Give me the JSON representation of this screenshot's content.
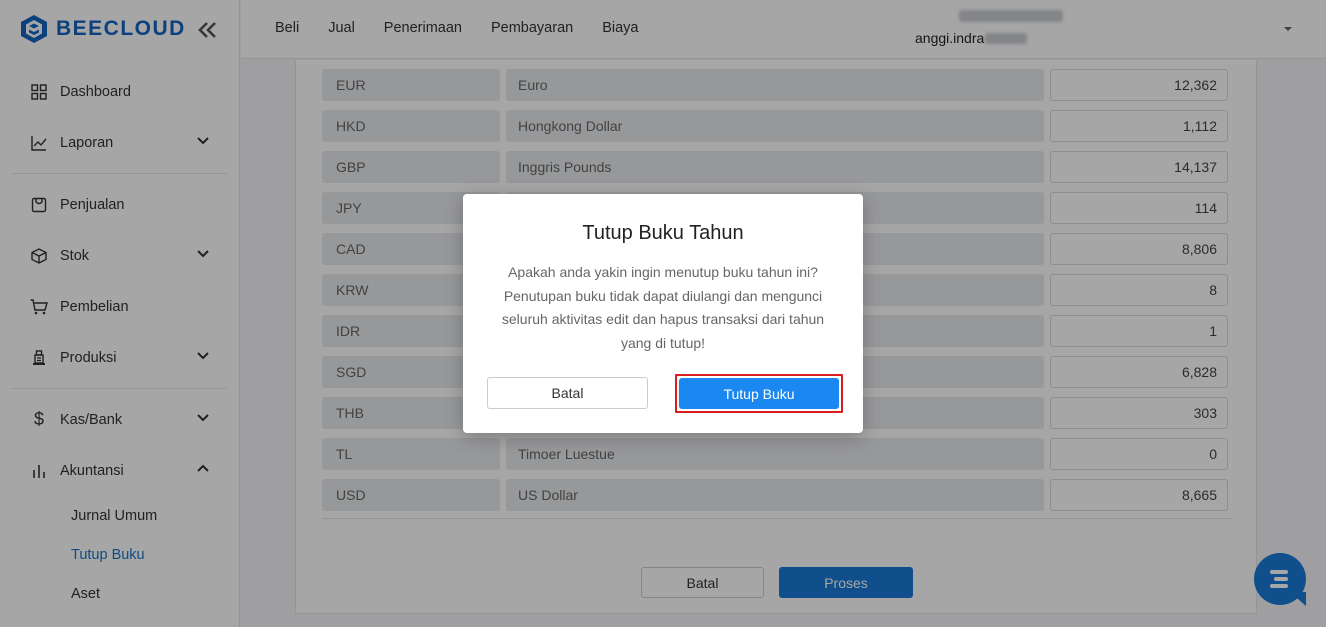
{
  "brand": {
    "name": "BEECLOUD",
    "color": "#1565c0"
  },
  "sidebar": {
    "items": [
      {
        "label": "Dashboard",
        "icon": "grid-icon"
      },
      {
        "label": "Laporan",
        "icon": "chart-line-icon"
      },
      {
        "label": "Penjualan",
        "icon": "receipt-icon"
      },
      {
        "label": "Stok",
        "icon": "box-icon"
      },
      {
        "label": "Pembelian",
        "icon": "cart-icon"
      },
      {
        "label": "Produksi",
        "icon": "factory-icon"
      },
      {
        "label": "Kas/Bank",
        "icon": "dollar-icon"
      },
      {
        "label": "Akuntansi",
        "icon": "bar-chart-icon"
      }
    ],
    "akuntansi_sub": [
      {
        "label": "Jurnal Umum"
      },
      {
        "label": "Tutup Buku"
      },
      {
        "label": "Aset"
      }
    ]
  },
  "topnav": {
    "items": [
      "Beli",
      "Jual",
      "Penerimaan",
      "Pembayaran",
      "Biaya"
    ]
  },
  "user": {
    "email_prefix": "anggi.indra"
  },
  "currency_table": {
    "rows": [
      {
        "code": "EUR",
        "name": "Euro",
        "rate": "12,362"
      },
      {
        "code": "HKD",
        "name": "Hongkong Dollar",
        "rate": "1,112"
      },
      {
        "code": "GBP",
        "name": "Inggris Pounds",
        "rate": "14,137"
      },
      {
        "code": "JPY",
        "name": "",
        "rate": "114"
      },
      {
        "code": "CAD",
        "name": "",
        "rate": "8,806"
      },
      {
        "code": "KRW",
        "name": "",
        "rate": "8"
      },
      {
        "code": "IDR",
        "name": "",
        "rate": "1"
      },
      {
        "code": "SGD",
        "name": "",
        "rate": "6,828"
      },
      {
        "code": "THB",
        "name": "",
        "rate": "303"
      },
      {
        "code": "TL",
        "name": "Timoer Luestue",
        "rate": "0"
      },
      {
        "code": "USD",
        "name": "US Dollar",
        "rate": "8,665"
      }
    ]
  },
  "footer_buttons": {
    "cancel": "Batal",
    "process": "Proses"
  },
  "modal": {
    "title": "Tutup Buku Tahun",
    "message": "Apakah anda yakin ingin menutup buku tahun ini? Penutupan buku tidak dapat diulangi dan mengunci seluruh aktivitas edit dan hapus transaksi dari tahun yang di tutup!",
    "cancel": "Batal",
    "confirm": "Tutup Buku",
    "highlight_color": "#d81e1e"
  },
  "colors": {
    "primary": "#1a7ad8",
    "active_link": "#1a73c9"
  }
}
